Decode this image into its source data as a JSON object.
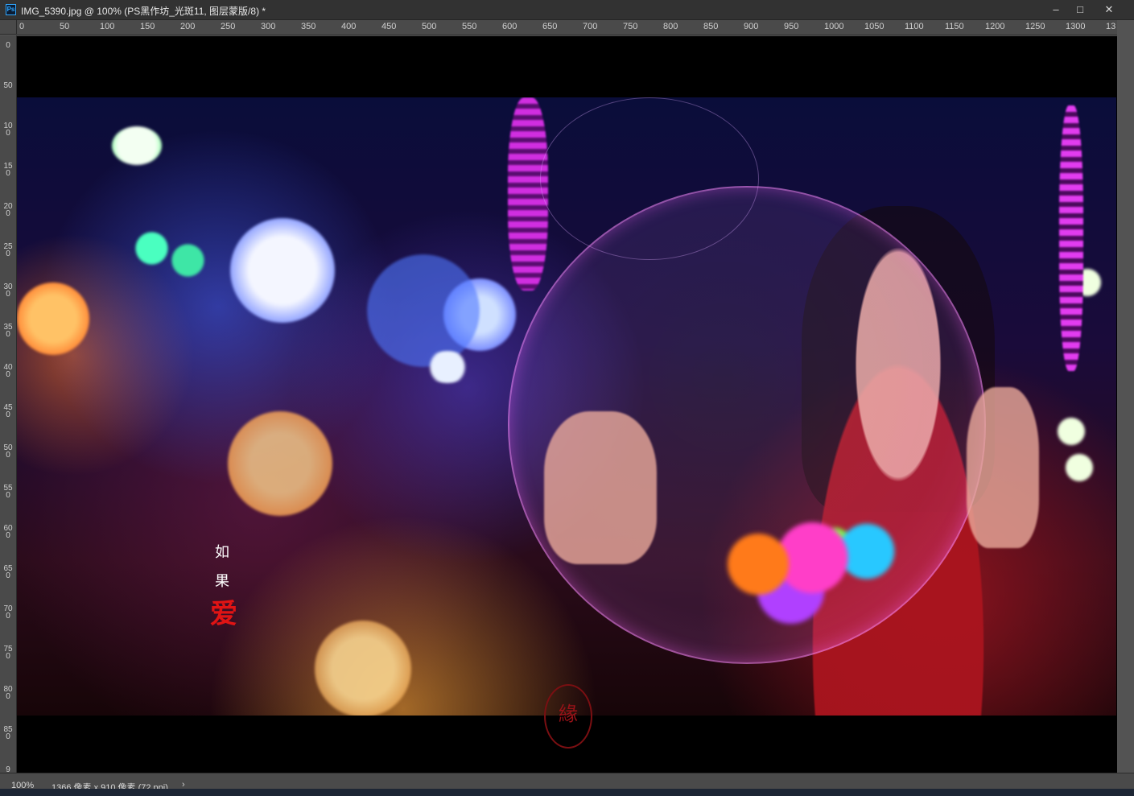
{
  "window": {
    "title": "IMG_5390.jpg @ 100% (PS黑作坊_光斑11, 图层蒙版/8) *",
    "app_icon": "photoshop-doc-icon",
    "controls": {
      "minimize": "‒",
      "maximize": "□",
      "close": "✕"
    }
  },
  "ruler": {
    "horizontal": [
      "0",
      "50",
      "100",
      "150",
      "200",
      "250",
      "300",
      "350",
      "400",
      "450",
      "500",
      "550",
      "600",
      "650",
      "700",
      "750",
      "800",
      "850",
      "900",
      "950",
      "1000",
      "1050",
      "1100",
      "1150",
      "1200",
      "1250",
      "1300",
      "13"
    ],
    "vertical": [
      "0",
      "50",
      "100",
      "150",
      "200",
      "250",
      "300",
      "350",
      "400",
      "450",
      "500",
      "550",
      "600",
      "650",
      "700",
      "750",
      "800",
      "850",
      "9"
    ]
  },
  "artwork": {
    "vertical_text": [
      "如",
      "果",
      "爱"
    ],
    "seal_text": "緣"
  },
  "status": {
    "zoom": "100%",
    "doc_info": "1366 像素 x 910 像素 (72 ppi)",
    "arrow": "›"
  },
  "colors": {
    "accent": "#31a8ff",
    "red_text": "#e01414"
  }
}
